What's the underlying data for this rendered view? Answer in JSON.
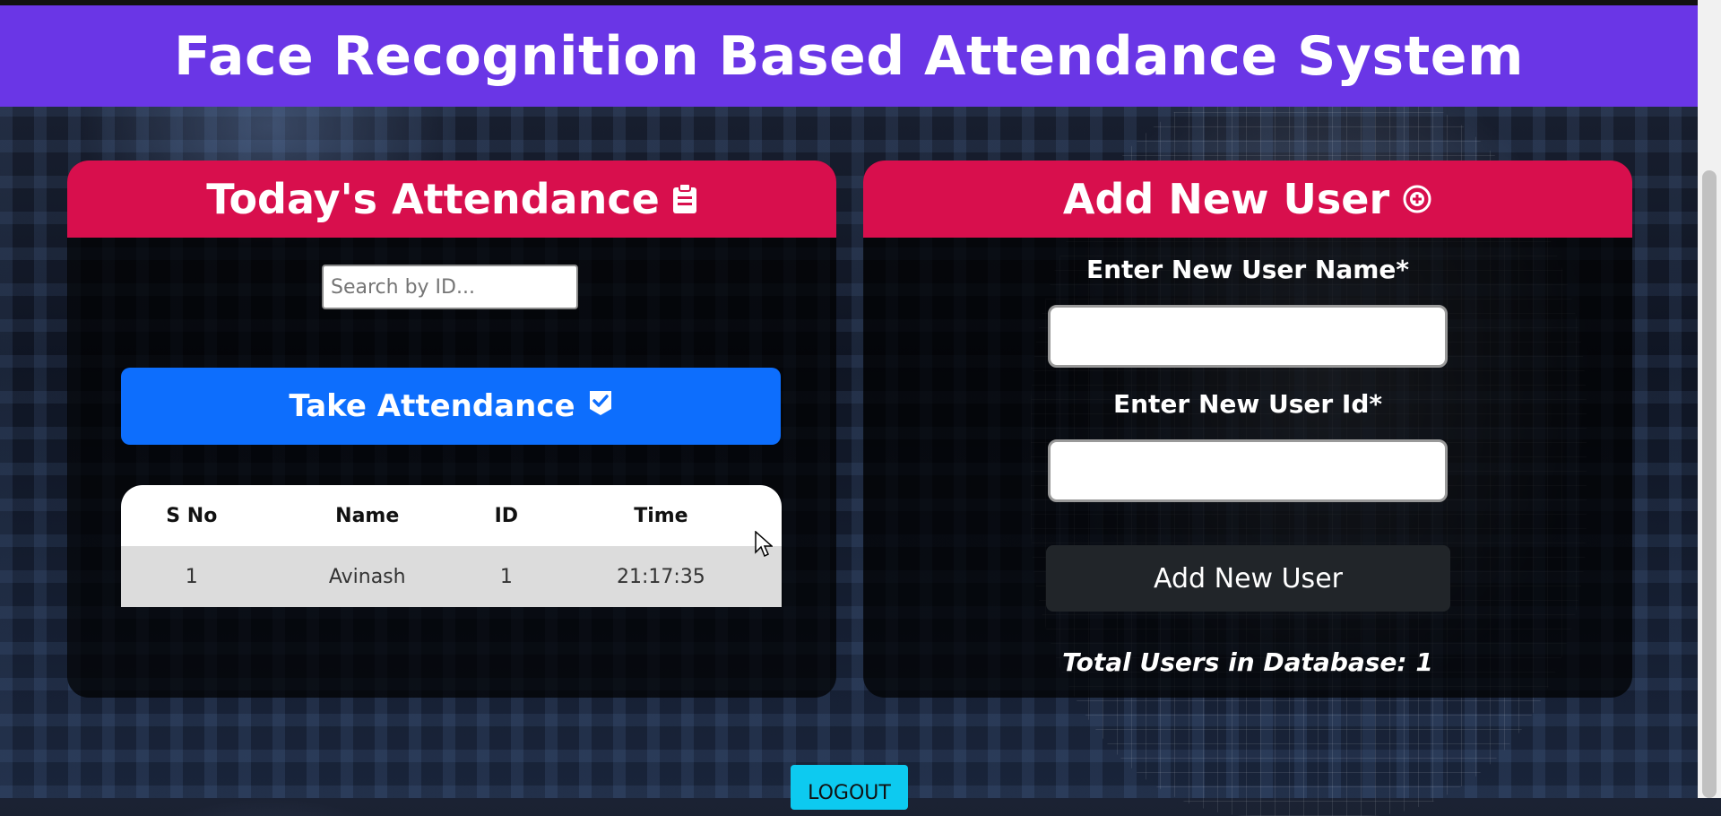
{
  "header": {
    "title": "Face Recognition Based Attendance System"
  },
  "attendance": {
    "title": "Today's Attendance",
    "title_icon": "clipboard-icon",
    "search_placeholder": "Search by ID...",
    "take_button": "Take Attendance",
    "take_button_icon": "check-square-icon",
    "columns": [
      "S No",
      "Name",
      "ID",
      "Time"
    ],
    "rows": [
      {
        "sno": "1",
        "name": "Avinash",
        "id": "1",
        "time": "21:17:35"
      }
    ]
  },
  "add_user": {
    "title": "Add New User",
    "title_icon": "plus-circle-icon",
    "name_label": "Enter New User Name*",
    "id_label": "Enter New User Id*",
    "name_value": "",
    "id_value": "",
    "button": "Add New User",
    "total_label": "Total Users in Database: 1"
  },
  "footer": {
    "logout": "LOGOUT"
  },
  "colors": {
    "header_bg": "#6a36e6",
    "panel_header_bg": "#d80f4d",
    "primary_button": "#0d6efd",
    "dark_button": "#212529",
    "logout_button": "#0dcaf0"
  }
}
